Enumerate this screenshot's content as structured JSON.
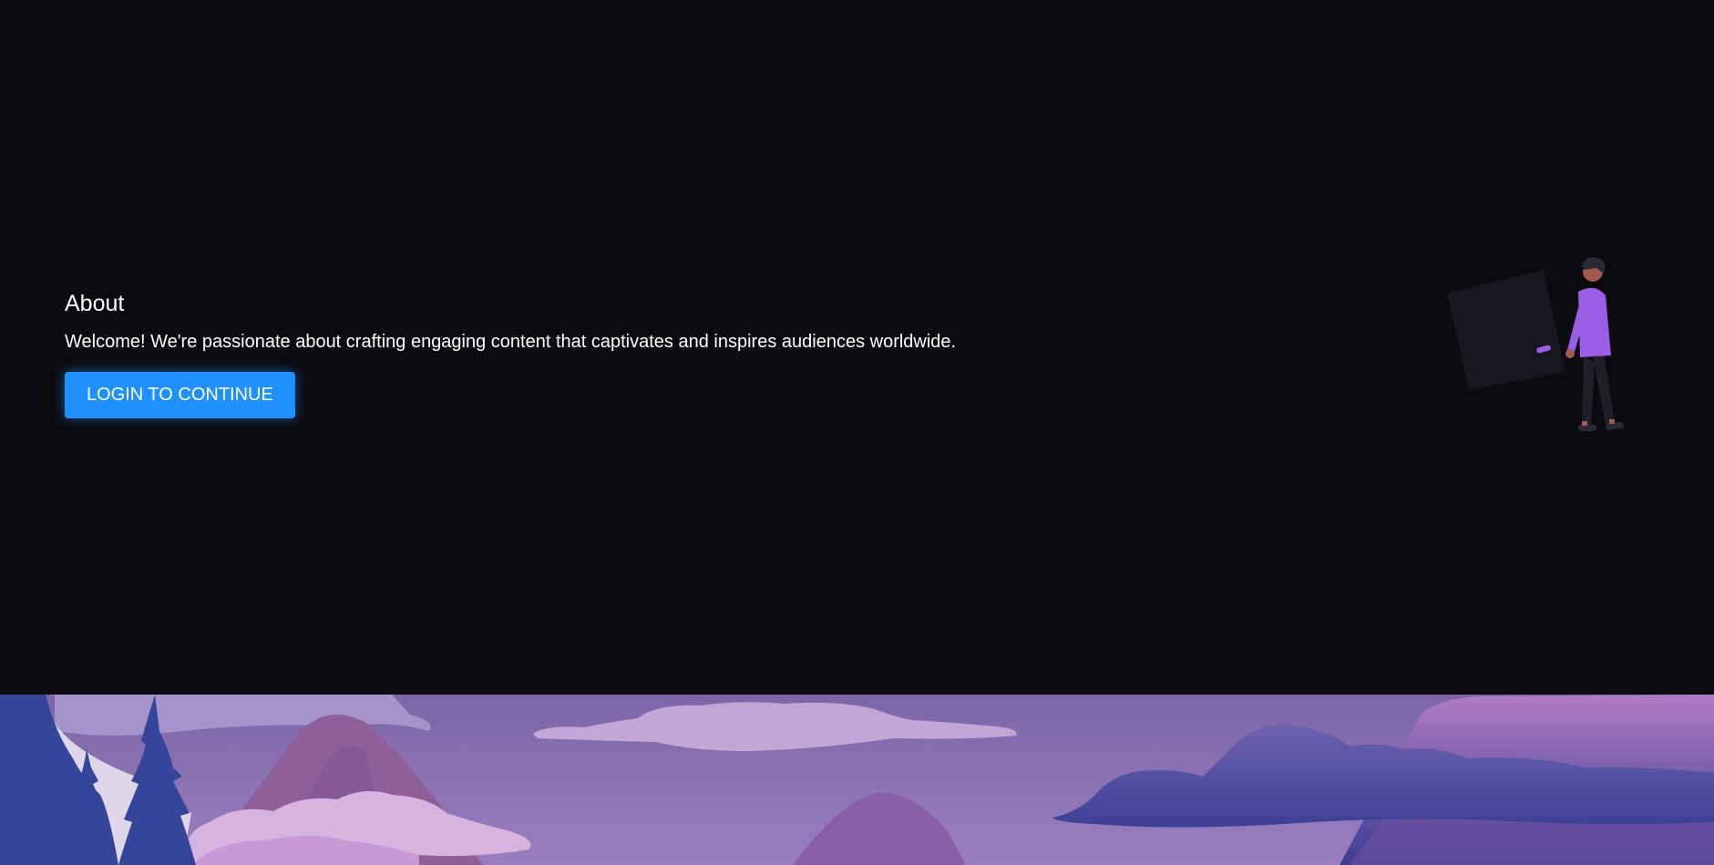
{
  "about": {
    "heading": "About",
    "description": "Welcome! We're passionate about crafting engaging content that captivates and inspires audiences worldwide.",
    "login_label": "LOGIN TO CONTINUE"
  },
  "illustration": {
    "icon": "person-holding-board-illustration",
    "accent_color": "#9b5de5",
    "board_color": "#17171f"
  },
  "landscape": {
    "icon": "mountain-landscape-illustration",
    "sky_color": "#8a72b8",
    "tree_color": "#35469a"
  },
  "colors": {
    "background": "#0b0b0f",
    "button": "#1e90ff",
    "text": "#ffffff"
  }
}
